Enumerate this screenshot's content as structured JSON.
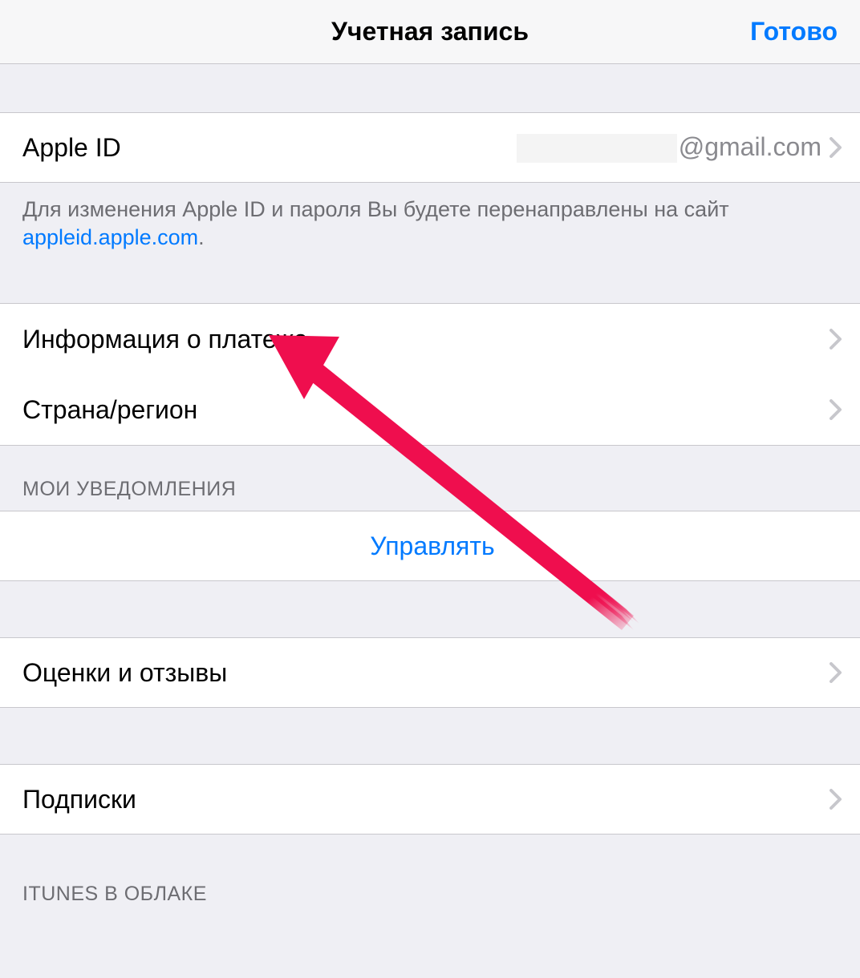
{
  "navbar": {
    "title": "Учетная запись",
    "done": "Готово"
  },
  "appleId": {
    "label": "Apple ID",
    "valueSuffix": "@gmail.com"
  },
  "footerNote": {
    "text": "Для изменения Apple ID и пароля Вы будете перенаправлены на сайт ",
    "link": "appleid.apple.com",
    "period": "."
  },
  "paymentInfo": {
    "label": "Информация о платеже"
  },
  "countryRegion": {
    "label": "Страна/регион"
  },
  "notificationsHeader": "МОИ УВЕДОМЛЕНИЯ",
  "manage": {
    "label": "Управлять"
  },
  "ratingsReviews": {
    "label": "Оценки и отзывы"
  },
  "subscriptions": {
    "label": "Подписки"
  },
  "itunesCloudHeader": "iTUNES В ОБЛАКЕ",
  "colors": {
    "accent": "#007aff",
    "annotation": "#ef0e4e"
  }
}
